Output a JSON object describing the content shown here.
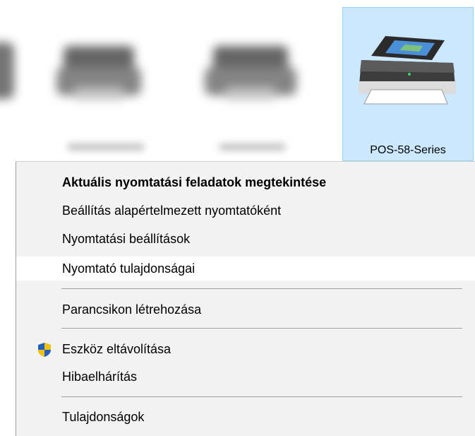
{
  "devices": {
    "selected_label": "POS-58-Series"
  },
  "context_menu": {
    "items": [
      {
        "label": "Aktuális nyomtatási feladatok megtekintése",
        "bold": true
      },
      {
        "label": "Beállítás alapértelmezett nyomtatóként"
      },
      {
        "label": "Nyomtatási beállítások"
      },
      {
        "label": "Nyomtató tulajdonságai",
        "highlighted": true
      },
      {
        "label": "Parancsikon létrehozása"
      },
      {
        "label": "Eszköz eltávolítása",
        "icon": "shield-icon"
      },
      {
        "label": "Hibaelhárítás"
      },
      {
        "label": "Tulajdonságok"
      }
    ]
  },
  "colors": {
    "selection_bg": "#cce8ff",
    "menu_bg": "#f2f2f2",
    "hover_bg": "#ffffff"
  }
}
